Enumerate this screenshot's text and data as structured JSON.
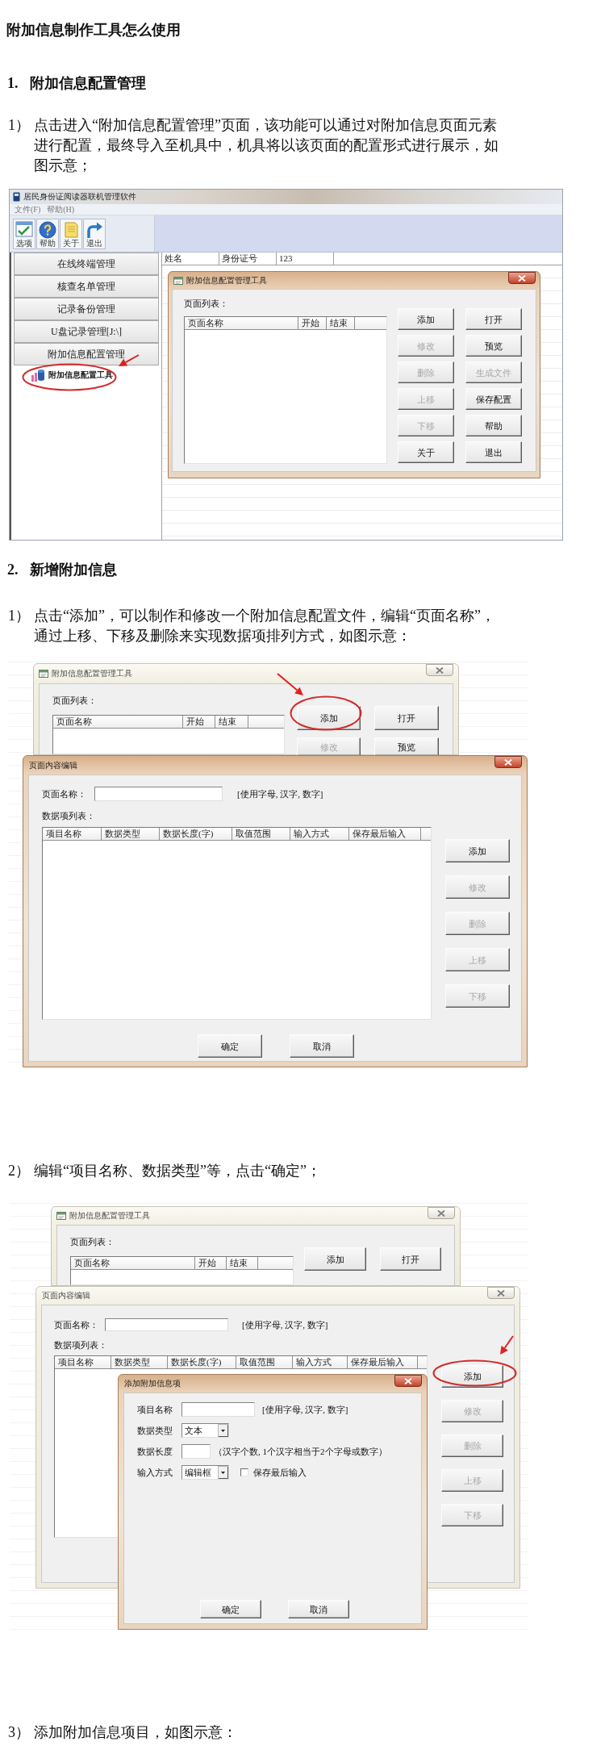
{
  "title": "附加信息制作工具怎么使用",
  "section_1": {
    "number": "1.",
    "heading": "附加信息配置管理"
  },
  "step_1_1": {
    "number": "1）",
    "text": "点击进入“附加信息配置管理”页面，该功能可以通过对附加信息页面元素进行配置，最终导入至机具中，机具将以该页面的配置形式进行展示，如图示意；"
  },
  "figure_1": {
    "app_window": {
      "title": "居民身份证阅读器联机管理软件",
      "menu": [
        "文件(F)",
        "帮助(H)"
      ],
      "toolbar": [
        "选项",
        "帮助",
        "关于",
        "退出"
      ],
      "nav": [
        "在线终端管理",
        "核查名单管理",
        "记录备份管理",
        "U盘记录管理[J:\\]",
        "附加信息配置管理"
      ],
      "tree": [
        {
          "label": "附加信息配置工具",
          "circled": true
        }
      ],
      "grid_columns": [
        "姓名",
        "身份证号",
        "123"
      ]
    },
    "dialog": {
      "title": "附加信息配置管理工具",
      "active": true,
      "list_label": "页面列表：",
      "columns": [
        "页面名称",
        "开始",
        "结束"
      ],
      "buttons": [
        {
          "label": "添加",
          "disabled": false
        },
        {
          "label": "打开",
          "disabled": false
        },
        {
          "label": "修改",
          "disabled": true
        },
        {
          "label": "预览",
          "disabled": false
        },
        {
          "label": "删除",
          "disabled": true
        },
        {
          "label": "生成文件",
          "disabled": true
        },
        {
          "label": "上移",
          "disabled": true
        },
        {
          "label": "保存配置",
          "disabled": false
        },
        {
          "label": "下移",
          "disabled": true
        },
        {
          "label": "帮助",
          "disabled": false
        },
        {
          "label": "关于",
          "disabled": false
        },
        {
          "label": "退出",
          "disabled": false
        }
      ]
    }
  },
  "section_2": {
    "number": "2.",
    "heading": "新增附加信息"
  },
  "step_2_1": {
    "number": "1）",
    "text": "点击“添加”，可以制作和修改一个附加信息配置文件，编辑“页面名称”，通过上移、下移及删除来实现数据项排列方式，如图示意："
  },
  "figure_2": {
    "config_window": {
      "title": "附加信息配置管理工具",
      "active": false,
      "list_label": "页面列表：",
      "columns": [
        "页面名称",
        "开始",
        "结束"
      ],
      "buttons": [
        {
          "label": "添加",
          "disabled": false,
          "circled": true
        },
        {
          "label": "打开",
          "disabled": false,
          "circled": false
        },
        {
          "label": "修改",
          "disabled": true,
          "circled": false
        },
        {
          "label": "预览",
          "disabled": false,
          "circled": false
        }
      ]
    },
    "page_editor": {
      "title": "页面内容编辑",
      "active": true,
      "name_label": "页面名称：",
      "name_hint": "[使用字母, 汉字, 数字]",
      "list_label": "数据项列表：",
      "columns": [
        "项目名称",
        "数据类型",
        "数据长度(字)",
        "取值范围",
        "输入方式",
        "保存最后输入"
      ],
      "buttons": [
        {
          "label": "添加",
          "disabled": false
        },
        {
          "label": "修改",
          "disabled": true
        },
        {
          "label": "删除",
          "disabled": true
        },
        {
          "label": "上移",
          "disabled": true
        },
        {
          "label": "下移",
          "disabled": true
        }
      ],
      "footer_buttons": [
        "确定",
        "取消"
      ]
    }
  },
  "step_2_2": {
    "number": "2）",
    "text": "编辑“项目名称、数据类型”等，点击“确定”；"
  },
  "figure_3": {
    "config_window": {
      "title": "附加信息配置管理工具",
      "active": false,
      "list_label": "页面列表：",
      "columns": [
        "页面名称",
        "开始",
        "结束"
      ],
      "buttons": [
        {
          "label": "添加",
          "disabled": false
        },
        {
          "label": "打开",
          "disabled": false
        }
      ]
    },
    "page_editor": {
      "title": "页面内容编辑",
      "active": false,
      "name_label": "页面名称：",
      "name_hint": "[使用字母, 汉字, 数字]",
      "list_label": "数据项列表：",
      "columns": [
        "项目名称",
        "数据类型",
        "数据长度(字)",
        "取值范围",
        "输入方式",
        "保存最后输入"
      ],
      "buttons": [
        {
          "label": "添加",
          "disabled": false,
          "circled": true
        },
        {
          "label": "修改",
          "disabled": true,
          "circled": false
        },
        {
          "label": "删除",
          "disabled": true,
          "circled": false
        },
        {
          "label": "上移",
          "disabled": true,
          "circled": false
        },
        {
          "label": "下移",
          "disabled": true,
          "circled": false
        }
      ]
    },
    "item_editor": {
      "title": "添加附加信息项",
      "active": true,
      "fields": [
        {
          "kind": "text",
          "label": "项目名称",
          "hint": "[使用字母, 汉字, 数字]"
        },
        {
          "kind": "dropdown",
          "label": "数据类型",
          "value": "文本"
        },
        {
          "kind": "short_text",
          "label": "数据长度",
          "hint": "（汉字个数, 1个汉字相当于2个字母或数字）"
        },
        {
          "kind": "dropdown",
          "label": "输入方式",
          "value": "编辑框",
          "checkbox": {
            "label": "保存最后输入",
            "checked": false
          }
        }
      ],
      "footer_buttons": [
        "确定",
        "取消"
      ]
    }
  },
  "step_2_3": {
    "number": "3）",
    "text": "添加附加信息项目，如图示意："
  }
}
